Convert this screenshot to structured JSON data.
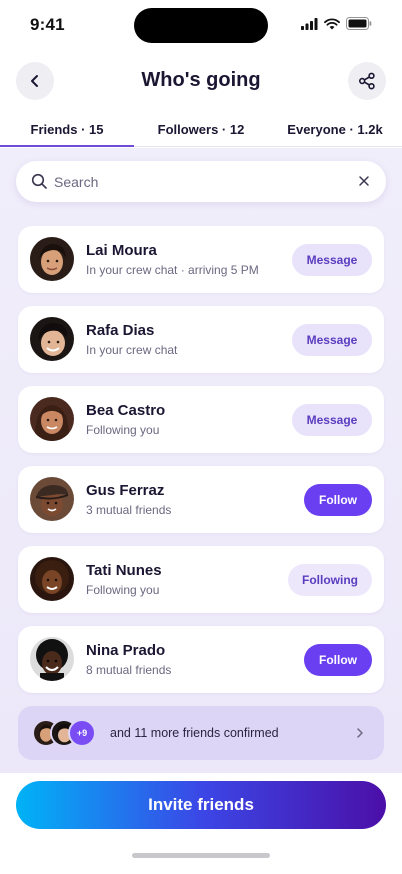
{
  "status_bar": {
    "time": "9:41"
  },
  "header": {
    "title": "Who's going"
  },
  "tabs": [
    {
      "label": "Friends · 15",
      "active": true
    },
    {
      "label": "Followers · 12",
      "active": false
    },
    {
      "label": "Everyone · 1.2k",
      "active": false
    }
  ],
  "search": {
    "placeholder": "Search",
    "value": ""
  },
  "people": [
    {
      "name": "Lai Moura",
      "subtitle": "In your crew chat · arriving 5 PM",
      "action": "Message",
      "action_type": "message"
    },
    {
      "name": "Rafa Dias",
      "subtitle": "In your crew chat",
      "action": "Message",
      "action_type": "message"
    },
    {
      "name": "Bea Castro",
      "subtitle": "Following you",
      "action": "Message",
      "action_type": "message"
    },
    {
      "name": "Gus Ferraz",
      "subtitle": "3 mutual friends",
      "action": "Follow",
      "action_type": "follow"
    },
    {
      "name": "Tati Nunes",
      "subtitle": "Following you",
      "action": "Following",
      "action_type": "following"
    },
    {
      "name": "Nina Prado",
      "subtitle": "8 mutual friends",
      "action": "Follow",
      "action_type": "follow"
    }
  ],
  "more": {
    "badge": "+9",
    "text": "and 11 more friends confirmed"
  },
  "footer": {
    "invite_label": "Invite friends"
  },
  "colors": {
    "accent": "#6a3ff2",
    "gradient_start": "#00b3f7",
    "gradient_end": "#4b0fa8"
  },
  "icons": [
    "back-arrow-icon",
    "share-icon",
    "search-icon",
    "close-icon",
    "chevron-right-icon",
    "signal-icon",
    "wifi-icon",
    "battery-icon"
  ]
}
